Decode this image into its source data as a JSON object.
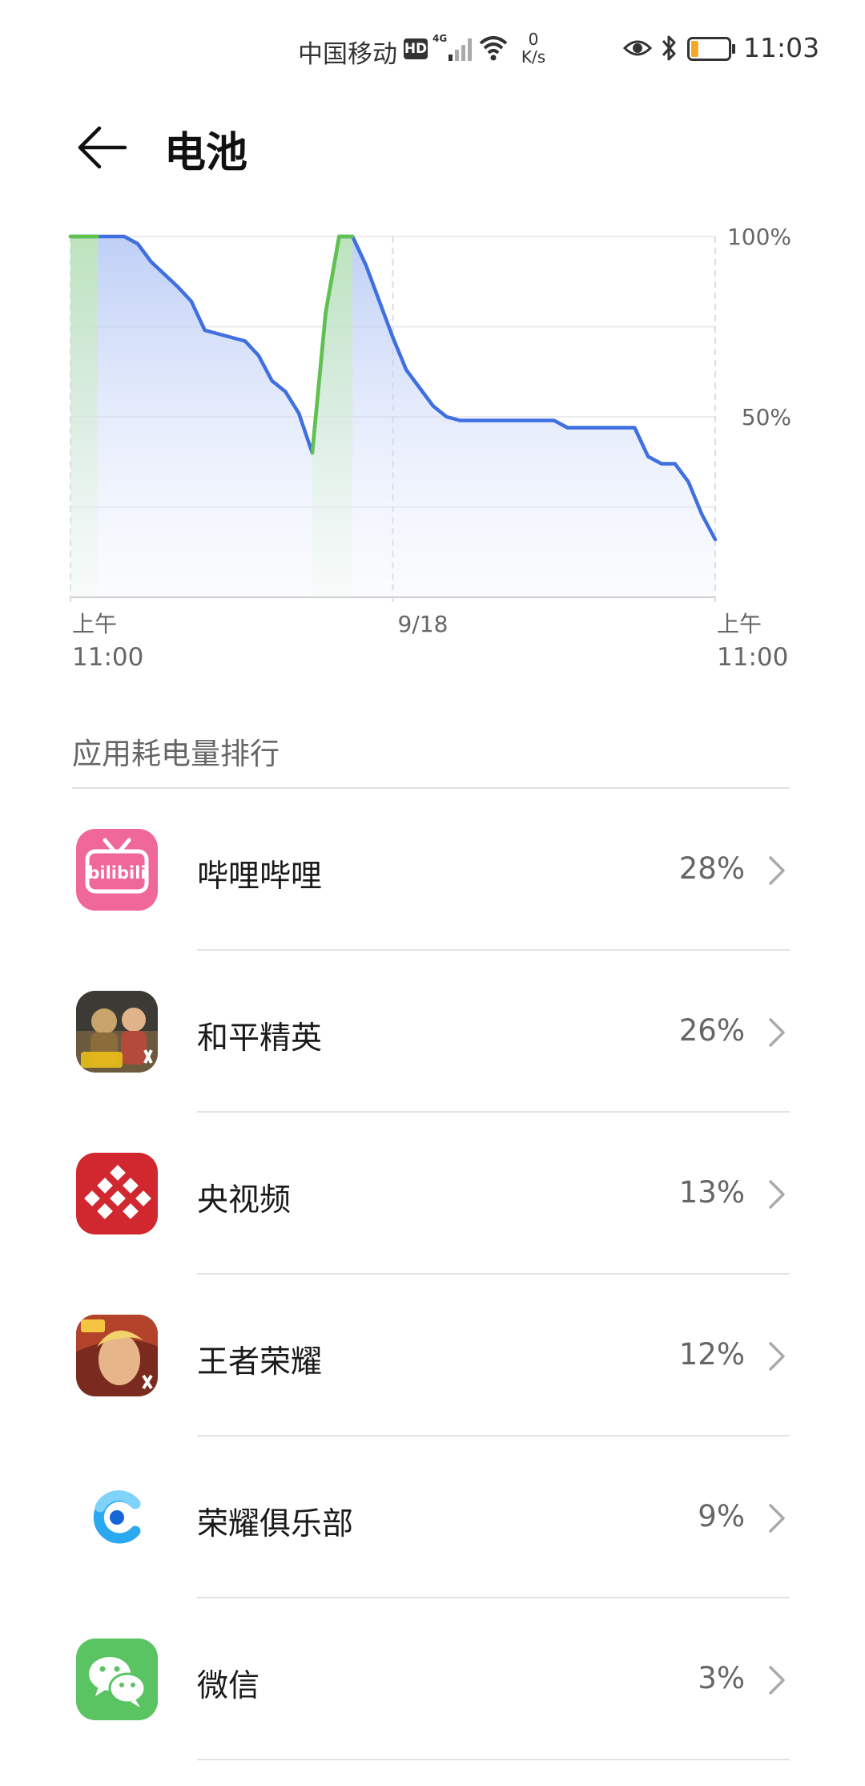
{
  "status_bar": {
    "carrier": "中国移动",
    "hd": "HD",
    "network": "4G",
    "speed_value": "0",
    "speed_unit": "K/s",
    "time": "11:03",
    "battery_level": 0.2
  },
  "header": {
    "title": "电池"
  },
  "chart_data": {
    "type": "area",
    "ylabel_ticks": [
      "100%",
      "50%"
    ],
    "x_labels": [
      {
        "top": "上午",
        "bottom": "11:00"
      },
      {
        "top": "9/18",
        "bottom": ""
      },
      {
        "top": "上午",
        "bottom": "11:00"
      }
    ],
    "ylim": [
      0,
      100
    ],
    "xlim": [
      0,
      24
    ],
    "grid": true,
    "series": [
      {
        "points": [
          [
            0,
            100
          ],
          [
            1,
            100
          ],
          [
            2,
            100
          ],
          [
            2.5,
            98
          ],
          [
            3,
            93
          ],
          [
            4,
            86
          ],
          [
            4.5,
            82
          ],
          [
            5,
            74
          ],
          [
            6.5,
            71
          ],
          [
            7,
            67
          ],
          [
            7.5,
            60
          ],
          [
            8,
            57
          ],
          [
            8.5,
            51
          ],
          [
            9,
            40
          ],
          [
            9.5,
            79
          ],
          [
            10,
            100
          ],
          [
            10.5,
            100
          ],
          [
            11,
            92
          ],
          [
            12,
            72
          ],
          [
            12.5,
            63
          ],
          [
            13,
            58
          ],
          [
            13.5,
            53
          ],
          [
            14,
            50
          ],
          [
            14.5,
            49
          ],
          [
            16,
            49
          ],
          [
            17,
            49
          ],
          [
            18,
            49
          ],
          [
            18.5,
            47
          ],
          [
            20,
            47
          ],
          [
            21,
            47
          ],
          [
            21.5,
            39
          ],
          [
            22,
            37
          ],
          [
            22.5,
            37
          ],
          [
            23,
            32
          ],
          [
            23.5,
            23
          ],
          [
            24,
            16
          ]
        ]
      }
    ],
    "charging_intervals": [
      [
        0,
        1
      ],
      [
        9,
        10.5
      ]
    ],
    "colors": {
      "discharge": "#3f6fe0",
      "charge": "#5fc24b"
    }
  },
  "section": {
    "title": "应用耗电量排行"
  },
  "apps": [
    {
      "name": "哔哩哔哩",
      "percent": "28%",
      "icon": "bilibili-icon"
    },
    {
      "name": "和平精英",
      "percent": "26%",
      "icon": "peace-elite-icon"
    },
    {
      "name": "央视频",
      "percent": "13%",
      "icon": "cctv-video-icon"
    },
    {
      "name": "王者荣耀",
      "percent": "12%",
      "icon": "honor-of-kings-icon"
    },
    {
      "name": "荣耀俱乐部",
      "percent": "9%",
      "icon": "honor-club-icon"
    },
    {
      "name": "微信",
      "percent": "3%",
      "icon": "wechat-icon"
    }
  ],
  "icon_texts": {
    "bilibili": "bilibili"
  }
}
